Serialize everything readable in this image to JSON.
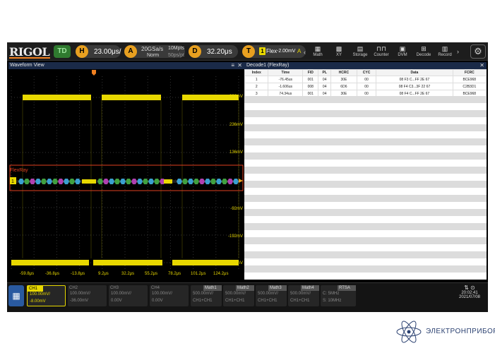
{
  "topbar": {
    "logo": "RIGOL",
    "mode": "TD",
    "h_icon": "H",
    "timebase": "23.00μs/",
    "a_icon": "A",
    "sample_rate": "20GSa/s",
    "acq_mode": "Norm",
    "memory_depth": "10Mpts",
    "memory_sub": "50ps/pt",
    "d_icon": "D",
    "delay": "32.20μs",
    "t_icon": "T",
    "trig_source": "1",
    "trig_type": "Flex",
    "trig_level": "-2.00mV",
    "trig_flag": "A",
    "tools": [
      {
        "label": "Math",
        "icon": "math-icon"
      },
      {
        "label": "XY",
        "icon": "xy-icon"
      },
      {
        "label": "Storage",
        "icon": "storage-icon"
      },
      {
        "label": "Counter",
        "icon": "counter-icon"
      },
      {
        "label": "DVM",
        "icon": "dvm-icon"
      },
      {
        "label": "Decode",
        "icon": "decode-icon"
      },
      {
        "label": "Record",
        "icon": "record-icon"
      }
    ]
  },
  "waveform": {
    "title": "Waveform View",
    "decode_label": "FlexRay",
    "y_labels": [
      "336mV",
      "236mV",
      "136mV",
      "-92mV",
      "-192mV",
      "-292mV"
    ],
    "x_labels": [
      "-59.8μs",
      "-36.8μs",
      "-13.8μs",
      "9.2μs",
      "32.2μs",
      "55.2μs",
      "78.2μs",
      "101.2μs",
      "124.2μs"
    ]
  },
  "decode": {
    "title": "Decode1 (FlexRay)",
    "columns": [
      "Index",
      "Time",
      "FID",
      "PL",
      "HCRC",
      "CYC",
      "Data",
      "FCRC"
    ],
    "rows": [
      [
        "1",
        "-76.45us",
        "001",
        "04",
        "30E",
        "00",
        "08 F3 C...FF 2E 67",
        "BCE968"
      ],
      [
        "2",
        "-1.606us",
        "008",
        "04",
        "6D6",
        "00",
        "08 F4 C3...3F 22 67",
        "C2B3D1"
      ],
      [
        "3",
        "74.34us",
        "001",
        "04",
        "30E",
        "00",
        "08 F4 C...FF 2E 67",
        "BCE968"
      ]
    ]
  },
  "bottombar": {
    "channels": [
      {
        "name": "CH1",
        "scale": "100.00mV/",
        "offset": "-8.00mV"
      },
      {
        "name": "CH2",
        "scale": "100.00mV/",
        "offset": "-36.00mV"
      },
      {
        "name": "CH3",
        "scale": "100.00mV/",
        "offset": "0.00V"
      },
      {
        "name": "CH4",
        "scale": "100.00mV/",
        "offset": "0.00V"
      }
    ],
    "maths": [
      {
        "name": "Math1",
        "scale": "500.00mV/",
        "src": "CH1+CH1"
      },
      {
        "name": "Math2",
        "scale": "500.00mV/",
        "src": "CH1+CH1"
      },
      {
        "name": "Math3",
        "scale": "500.00mV/",
        "src": "CH1+CH1"
      },
      {
        "name": "Math4",
        "scale": "500.00mV/",
        "src": "CH1+CH1"
      }
    ],
    "rtsa": {
      "name": "RTSA",
      "center": "C: 5MHz",
      "span": "S: 10MHz"
    },
    "time": "20:02:41",
    "date": "2021/07/08"
  },
  "watermark": {
    "text": "ЭЛЕКТРОНПРИБОР"
  }
}
